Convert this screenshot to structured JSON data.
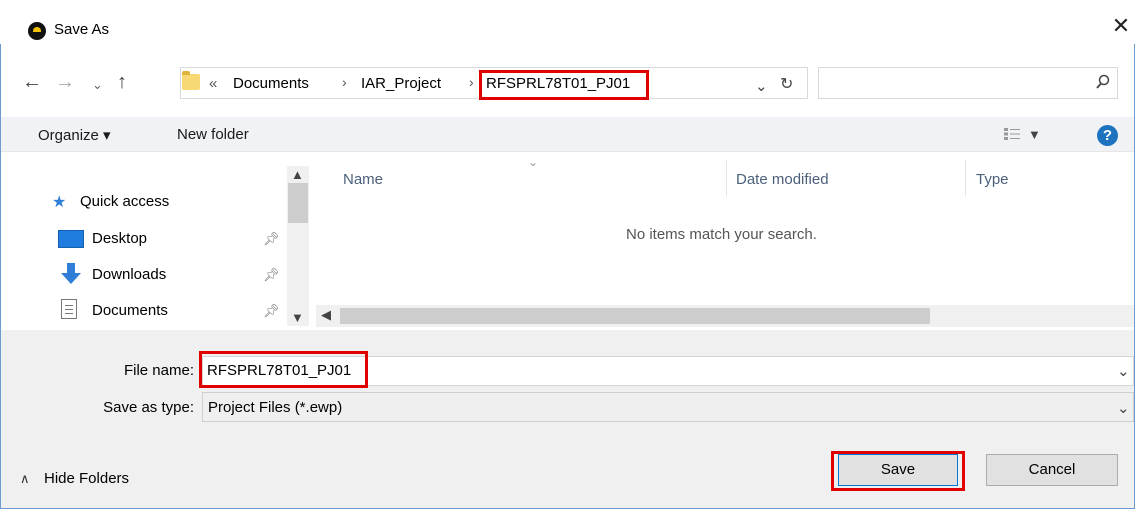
{
  "window": {
    "title": "Save As",
    "close_glyph": "✕"
  },
  "address_bar": {
    "overflow": "«",
    "crumbs": [
      "Documents",
      "IAR_Project",
      "RFSPRL78T01_PJ01"
    ],
    "highlight_color": "#e00000",
    "search_placeholder": ""
  },
  "toolbar": {
    "organize": "Organize ▾",
    "new_folder": "New folder",
    "help": "?"
  },
  "sidebar": {
    "quick_access": "Quick access",
    "items": [
      {
        "label": "Desktop",
        "icon": "desktop-icon"
      },
      {
        "label": "Downloads",
        "icon": "download-arrow-icon"
      },
      {
        "label": "Documents",
        "icon": "document-icon"
      }
    ]
  },
  "file_list": {
    "columns": [
      "Name",
      "Date modified",
      "Type"
    ],
    "empty_message": "No items match your search."
  },
  "form": {
    "file_name_label": "File name:",
    "file_name_value": "RFSPRL78T01_PJ01",
    "save_type_label": "Save as type:",
    "save_type_value": "Project Files (*.ewp)"
  },
  "footer": {
    "hide_folders": "Hide Folders",
    "save": "Save",
    "cancel": "Cancel"
  }
}
